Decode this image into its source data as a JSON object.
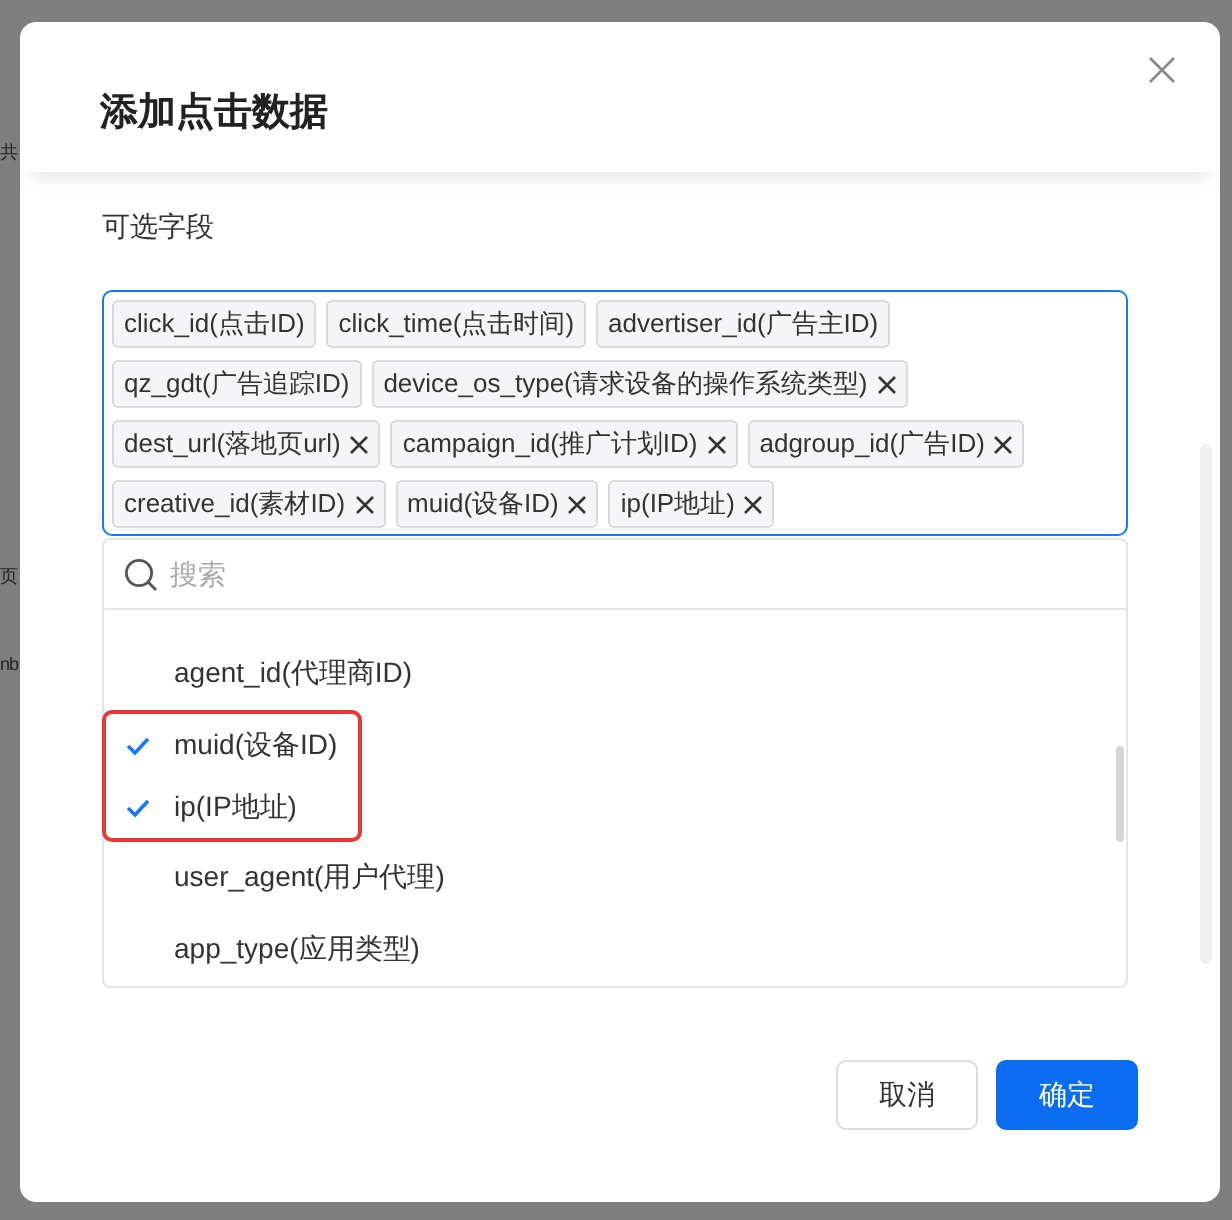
{
  "background": {
    "texts": [
      "共",
      "页",
      "nb"
    ]
  },
  "dialog": {
    "title": "添加点击数据",
    "field_label": "可选字段",
    "tags": [
      {
        "label": "click_id(点击ID)",
        "closable": false
      },
      {
        "label": "click_time(点击时间)",
        "closable": false
      },
      {
        "label": "advertiser_id(广告主ID)",
        "closable": false
      },
      {
        "label": "qz_gdt(广告追踪ID)",
        "closable": false
      },
      {
        "label": "device_os_type(请求设备的操作系统类型)",
        "closable": true
      },
      {
        "label": "dest_url(落地页url)",
        "closable": true
      },
      {
        "label": "campaign_id(推广计划ID)",
        "closable": true
      },
      {
        "label": "adgroup_id(广告ID)",
        "closable": true
      },
      {
        "label": "creative_id(素材ID)",
        "closable": true
      },
      {
        "label": "muid(设备ID)",
        "closable": true
      },
      {
        "label": "ip(IP地址)",
        "closable": true
      }
    ],
    "search": {
      "placeholder": "搜索"
    },
    "options": [
      {
        "label": "agent_id(代理商ID)",
        "selected": false,
        "highlighted": false
      },
      {
        "label": "muid(设备ID)",
        "selected": true,
        "highlighted": true
      },
      {
        "label": "ip(IP地址)",
        "selected": true,
        "highlighted": true
      },
      {
        "label": "user_agent(用户代理)",
        "selected": false,
        "highlighted": false
      },
      {
        "label": "app_type(应用类型)",
        "selected": false,
        "highlighted": false
      }
    ],
    "buttons": [
      {
        "label": "取消",
        "kind": "secondary"
      },
      {
        "label": "确定",
        "kind": "primary"
      }
    ]
  }
}
